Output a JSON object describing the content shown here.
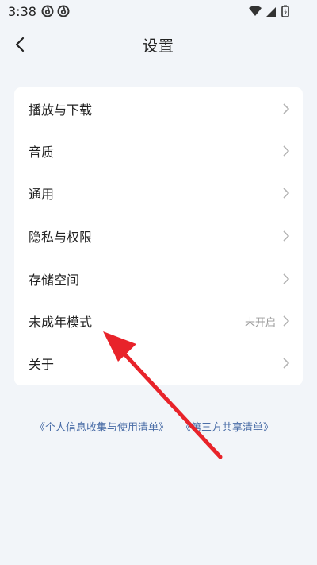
{
  "status_bar": {
    "time": "3:38",
    "app_icons": [
      "netease-cloud-music-icon",
      "netease-cloud-music-icon"
    ],
    "right_icons": [
      "wifi-icon",
      "signal-icon",
      "battery-icon"
    ]
  },
  "header": {
    "title": "设置",
    "back_icon": "chevron-left-icon"
  },
  "settings": {
    "items": [
      {
        "label": "播放与下载",
        "value": ""
      },
      {
        "label": "音质",
        "value": ""
      },
      {
        "label": "通用",
        "value": ""
      },
      {
        "label": "隐私与权限",
        "value": ""
      },
      {
        "label": "存储空间",
        "value": ""
      },
      {
        "label": "未成年模式",
        "value": "未开启"
      },
      {
        "label": "关于",
        "value": ""
      }
    ]
  },
  "footer": {
    "link_personal_info": "《个人信息收集与使用清单》",
    "link_third_party": "《第三方共享清单》"
  },
  "colors": {
    "background": "#f2f5f9",
    "card": "#ffffff",
    "link": "#4a6da7",
    "annotation_arrow": "#e8232a"
  }
}
